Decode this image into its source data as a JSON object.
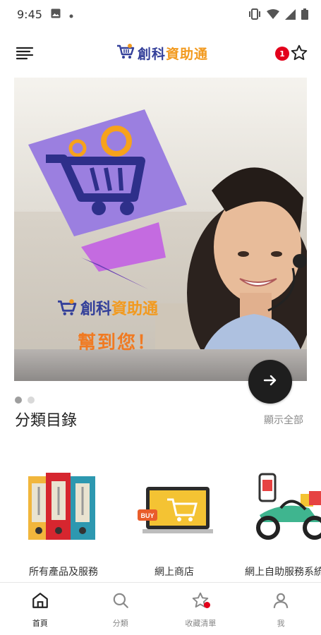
{
  "status_bar": {
    "time": "9:45"
  },
  "app_bar": {
    "logo_text_blue": "創科",
    "logo_text_orange": "資助通",
    "notification_count": "1"
  },
  "banner": {
    "caption_blue": "創科",
    "caption_orange": "資助通",
    "caption_slogan": "幫到您！"
  },
  "section": {
    "title": "分類目錄",
    "show_all": "顯示全部"
  },
  "categories": [
    {
      "label": "所有產品及服務",
      "icon": "binders-icon"
    },
    {
      "label": "網上商店",
      "icon": "online-shop-icon"
    },
    {
      "label": "網上自助服務系統",
      "icon": "delivery-motorbike-icon"
    }
  ],
  "bottom_nav": [
    {
      "label": "首頁",
      "icon": "home-icon"
    },
    {
      "label": "分類",
      "icon": "search-icon"
    },
    {
      "label": "收藏清單",
      "icon": "star-icon"
    },
    {
      "label": "我",
      "icon": "person-icon"
    }
  ],
  "colors": {
    "brand_blue": "#34409a",
    "brand_orange": "#f29a1f",
    "badge_red": "#e3001b"
  }
}
